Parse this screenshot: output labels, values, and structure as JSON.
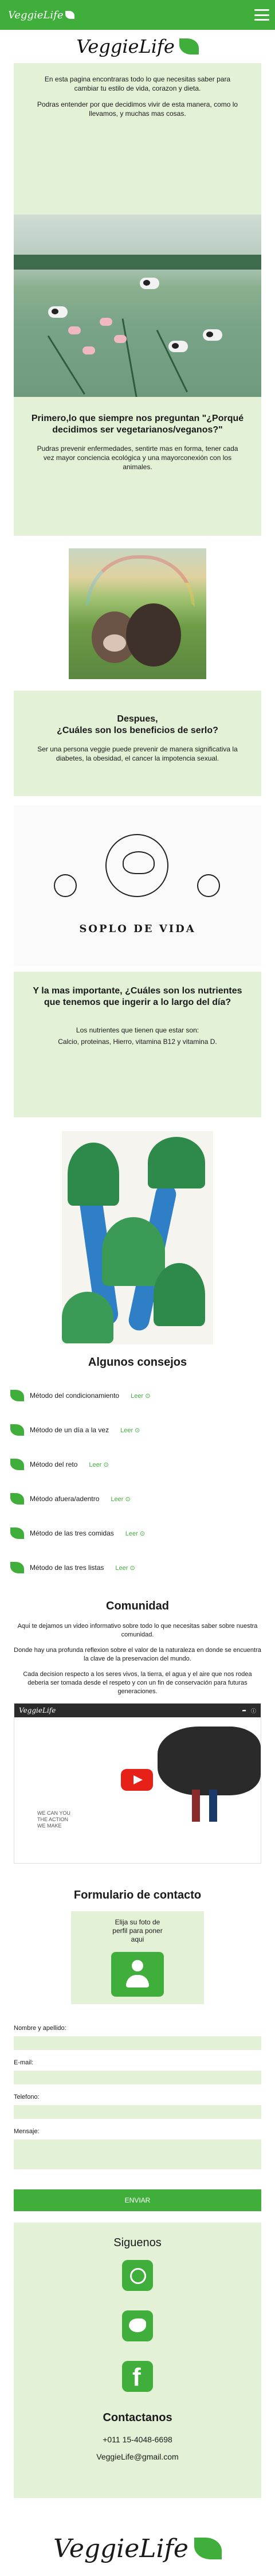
{
  "topbar": {
    "brand": "VeggieLife"
  },
  "hero": {
    "brand": "VeggieLife"
  },
  "intro": {
    "p1": "En esta pagina encontraras todo lo que  necesitas saber para cambiar tu estilo de vida, corazon y dieta.",
    "p2": "Podras entender por que decidimos vivir de esta manera, como lo llevamos, y muchas mas cosas."
  },
  "question1": {
    "title": "Primero,lo que siempre nos  preguntan \"¿Porqué decidimos ser  vegetarianos/veganos?\"",
    "body": "Pudras prevenir enfermedades, sentirte mas en forma, tener cada vez mayor conciencia ecológica y una mayorconexión con los animales."
  },
  "question2": {
    "title_line1": "Despues,",
    "title_line2": "¿Cuáles son los beneficios de serlo?",
    "body": "Ser una persona veggie puede prevenir de manera significativa la diabetes, la obesidad, el cancer la impotencia sexual."
  },
  "sketch": {
    "caption": "SOPLO DE VIDA"
  },
  "question3": {
    "title": "Y la mas importante, ¿Cuáles son los nutrientes que tenemos que ingerir a lo largo del día?",
    "body_line1": "Los nutrientes que tienen que estar son:",
    "body_line2": "Calcio, proteinas, Hierro, vitamina B12 y vitamina D."
  },
  "tips": {
    "title": "Algunos consejos",
    "link": "Leer",
    "items": [
      "Método del condicionamiento",
      "Método de un día a la vez",
      "Método del reto",
      "Método afuera/adentro",
      "Método de las tres comidas",
      "Método de las tres listas"
    ]
  },
  "comunidad": {
    "title": "Comunidad",
    "p1": "Aqui te dejamos un video informativo sobre todo lo que necesitas saber sobre nuestra comunidad.",
    "p2": "Donde hay una profunda reflexion sobre el valor de la naturaleza en donde se encuentra  la clave de la preservacion del mundo.",
    "p3": "Cada decision respecto a los seres  vivos, la tierra, el agua y el aire que nos rodea deberia ser tomada desde el respeto y con un fin de conservación para futuras generaciones."
  },
  "video": {
    "channel": "VeggieLife",
    "caption": "WE CAN YOU\nTHE ACTION\nWE MAKE"
  },
  "form": {
    "title": "Formulario de contacto",
    "upload_hint": "Elija su foto de perfil para poner aqui",
    "name_label": "Nombre y apellido:",
    "email_label": "E-mail:",
    "phone_label": "Telefono:",
    "message_label": "Mensaje:",
    "submit": "ENVIAR"
  },
  "footer": {
    "social_title": "Siguenos",
    "contact_title": "Contactanos",
    "phone": "+011 15-4048-6698",
    "email": "VeggieLife@gmail.com",
    "brand": "VeggieLife"
  },
  "colors": {
    "accent": "#3fae3a",
    "panel": "#e3f1d6"
  }
}
